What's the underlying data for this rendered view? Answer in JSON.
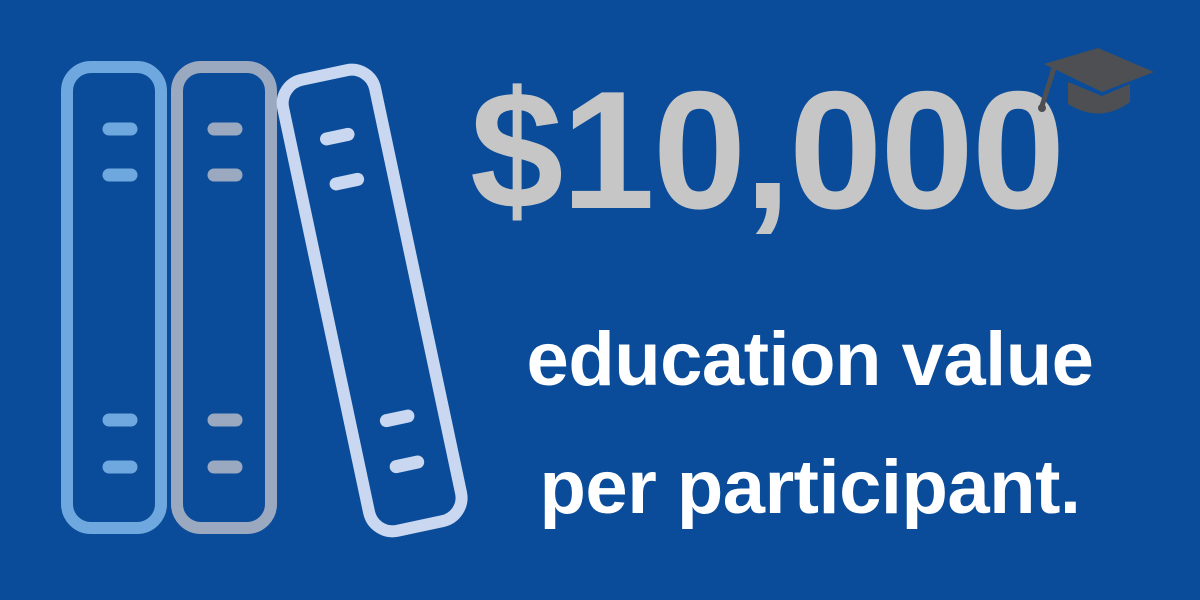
{
  "headline": {
    "amount": "$10,000",
    "line1": "education value",
    "line2": "per participant."
  },
  "icons": {
    "books": "books-icon",
    "graduation_cap": "graduation-cap-icon"
  },
  "colors": {
    "background": "#0a4c99",
    "amount_text": "#c6c6c6",
    "caption_text": "#ffffff",
    "book_1": "#6fa8de",
    "book_2": "#9aa9c0",
    "book_3": "#c9d8f0",
    "cap": "#4d4f53"
  }
}
